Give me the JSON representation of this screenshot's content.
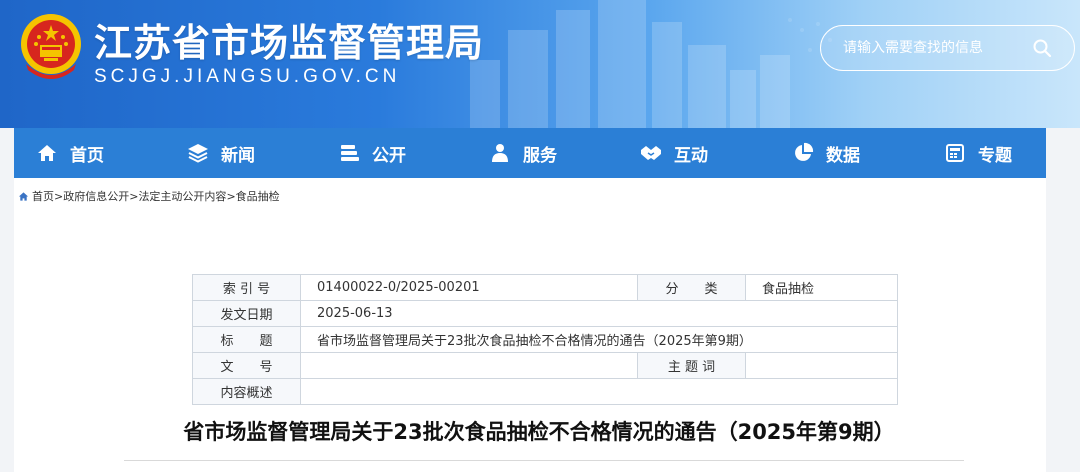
{
  "header": {
    "site_title": "江苏省市场监督管理局",
    "site_domain": "SCJGJ.JIANGSU.GOV.CN",
    "search_placeholder": "请输入需要查找的信息"
  },
  "nav": {
    "items": [
      {
        "label": "首页",
        "icon": "home-icon"
      },
      {
        "label": "新闻",
        "icon": "layers-icon"
      },
      {
        "label": "公开",
        "icon": "stack-icon"
      },
      {
        "label": "服务",
        "icon": "users-icon"
      },
      {
        "label": "互动",
        "icon": "handshake-icon"
      },
      {
        "label": "数据",
        "icon": "pie-chart-icon"
      },
      {
        "label": "专题",
        "icon": "calculator-icon"
      }
    ]
  },
  "breadcrumb": {
    "items": [
      "首页",
      "政府信息公开",
      "法定主动公开内容",
      "食品抽检"
    ],
    "separator": ">"
  },
  "meta": {
    "index_label": "索 引 号",
    "index_value": "01400022-0/2025-00201",
    "category_label": "分　　类",
    "category_value": "食品抽检",
    "date_label": "发文日期",
    "date_value": "2025-06-13",
    "title_label": "标　　题",
    "title_value": "省市场监督管理局关于23批次食品抽检不合格情况的通告（2025年第9期）",
    "docno_label": "文　　号",
    "docno_value": "",
    "subject_label": "主 题 词",
    "subject_value": "",
    "summary_label": "内容概述",
    "summary_value": ""
  },
  "document": {
    "title": "省市场监督管理局关于23批次食品抽检不合格情况的通告（2025年第9期）"
  },
  "colors": {
    "nav_bg": "#2b7fd6",
    "banner_start": "#1f66c8",
    "emblem_red": "#d7261e",
    "emblem_gold": "#f5c400"
  }
}
